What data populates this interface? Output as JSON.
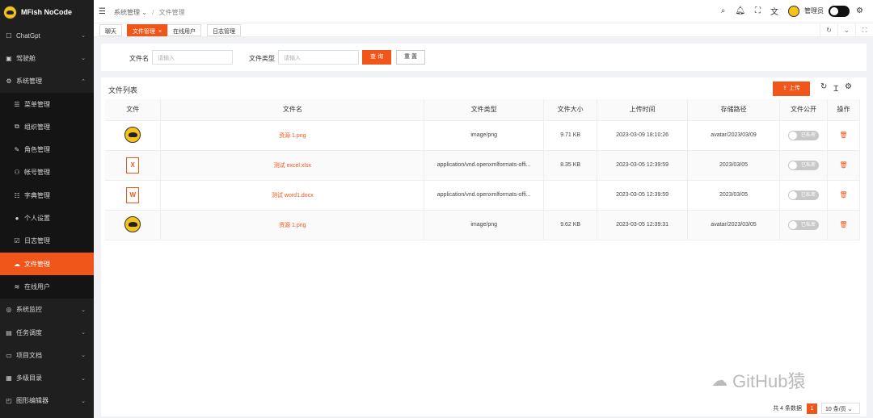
{
  "app": {
    "name": "MFish NoCode"
  },
  "sidebar": {
    "items": [
      {
        "label": "ChatGpt",
        "icon": "chat-icon",
        "glyph": "☐",
        "chevron": "⌄"
      },
      {
        "label": "驾驶舱",
        "icon": "cockpit-icon",
        "glyph": "▣",
        "chevron": "⌄"
      },
      {
        "label": "系统管理",
        "icon": "gear-icon",
        "glyph": "⚙",
        "chevron": "⌃"
      },
      {
        "label": "菜单管理",
        "icon": "menu-icon",
        "glyph": "☰"
      },
      {
        "label": "组织管理",
        "icon": "org-icon",
        "glyph": "⧉"
      },
      {
        "label": "角色管理",
        "icon": "role-icon",
        "glyph": "✎"
      },
      {
        "label": "帐号管理",
        "icon": "users-icon",
        "glyph": "⚇"
      },
      {
        "label": "字典管理",
        "icon": "dictionary-icon",
        "glyph": "☷"
      },
      {
        "label": "个人设置",
        "icon": "user-icon",
        "glyph": "●"
      },
      {
        "label": "日志管理",
        "icon": "log-icon",
        "glyph": "☑"
      },
      {
        "label": "文件管理",
        "icon": "folder-icon",
        "glyph": "☁"
      },
      {
        "label": "在线用户",
        "icon": "wifi-icon",
        "glyph": "≋"
      },
      {
        "label": "系统监控",
        "icon": "monitor-icon",
        "glyph": "◎",
        "chevron": "⌄"
      },
      {
        "label": "任务调度",
        "icon": "schedule-icon",
        "glyph": "▤",
        "chevron": "⌄"
      },
      {
        "label": "项目文档",
        "icon": "docs-icon",
        "glyph": "▭",
        "chevron": "⌄"
      },
      {
        "label": "多级目录",
        "icon": "tree-icon",
        "glyph": "▦",
        "chevron": "⌄"
      },
      {
        "label": "图形编辑器",
        "icon": "graph-icon",
        "glyph": "◰",
        "chevron": "⌄"
      }
    ]
  },
  "header": {
    "breadcrumb": [
      "系统管理",
      "文件管理"
    ],
    "breadcrumb_dropdown": "⌄",
    "breadcrumb_sep": "/",
    "admin_name": "管理员"
  },
  "tabs": [
    {
      "label": "聊天",
      "close": ""
    },
    {
      "label": "文件管理",
      "close": "×"
    },
    {
      "label": "在线用户",
      "close": ""
    },
    {
      "label": "日志管理",
      "close": ""
    }
  ],
  "search": {
    "filename_label": "文件名",
    "filename_placeholder": "请输入",
    "filetype_label": "文件类型",
    "filetype_placeholder": "请输入",
    "search_button": "查 询",
    "reset_button": "重 置"
  },
  "list": {
    "title": "文件列表",
    "upload_button": "上传",
    "columns": [
      "文件",
      "文件名",
      "文件类型",
      "文件大小",
      "上传时间",
      "存储路径",
      "文件公开",
      "操作"
    ],
    "rows": [
      {
        "preview": "avatar",
        "name": "资源 1.png",
        "type": "image/png",
        "size": "9.71 KB",
        "time": "2023-03-09 18:10:26",
        "path": "avatar/2023/03/09",
        "public": "已私密"
      },
      {
        "preview": "excel",
        "preview_letter": "X",
        "name": "测试 excel.xlsx",
        "type": "application/vnd.openxmlformats-offi...",
        "size": "8.35 KB",
        "time": "2023-03-05 12:39:59",
        "path": "2023/03/05",
        "public": "已私密"
      },
      {
        "preview": "word",
        "preview_letter": "W",
        "name": "测试 word1.docx",
        "type": "application/vnd.openxmlformats-offi...",
        "size": "",
        "time": "2023-03-05 12:39:59",
        "path": "2023/03/05",
        "public": "已私密"
      },
      {
        "preview": "avatar",
        "name": "资源 1.png",
        "type": "image/png",
        "size": "9.62 KB",
        "time": "2023-03-05 12:39:31",
        "path": "avatar/2023/03/05",
        "public": "已私密"
      }
    ]
  },
  "pagination": {
    "total": "共 4 条数据",
    "current": "1",
    "page_size": "10 条/页 ⌄"
  },
  "watermark": "GitHub猿",
  "colors": {
    "accent": "#f0561a",
    "sidebar_bg": "#1f1f1f"
  }
}
